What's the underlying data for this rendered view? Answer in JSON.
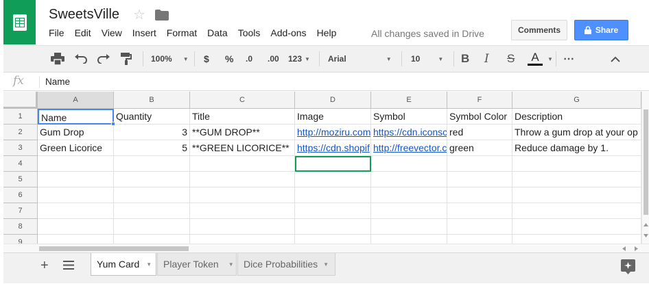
{
  "app": {
    "title": "SweetsVille",
    "saved_status": "All changes saved in Drive",
    "menu": [
      "File",
      "Edit",
      "View",
      "Insert",
      "Format",
      "Data",
      "Tools",
      "Add-ons",
      "Help"
    ],
    "comments_label": "Comments",
    "share_label": "Share"
  },
  "toolbar": {
    "zoom": "100%",
    "currency": "$",
    "percent": "%",
    "dec_decrease": ".0",
    "dec_increase": ".00",
    "more_formats": "123",
    "font": "Arial",
    "font_size": "10",
    "bold": "B",
    "italic": "I",
    "strike": "S",
    "text_color": "A",
    "more": "⋯",
    "collapse": "^"
  },
  "formula_bar": {
    "fx": "fx",
    "value": "Name"
  },
  "grid": {
    "columns": [
      "A",
      "B",
      "C",
      "D",
      "E",
      "F",
      "G"
    ],
    "row_numbers": [
      "1",
      "2",
      "3",
      "4",
      "5",
      "6",
      "7",
      "8",
      "9"
    ],
    "rows": [
      [
        "Name",
        "Quantity",
        "Title",
        "Image",
        "Symbol",
        "Symbol Color",
        "Description"
      ],
      [
        "Gum Drop",
        "3",
        "**GUM DROP**",
        "http://moziru.com",
        "https://cdn.iconsc",
        "red",
        "Throw a gum drop at your op"
      ],
      [
        "Green Licorice",
        "5",
        "**GREEN LICORICE**",
        "https://cdn.shopif",
        "http://freevector.c",
        "green",
        "Reduce damage by 1."
      ]
    ]
  },
  "sheets": {
    "tabs": [
      "Yum Card",
      "Player Token",
      "Dice Probabilities"
    ],
    "active": "Yum Card"
  },
  "colors": {
    "brand": "#0f9d58",
    "share": "#4d90fe",
    "selection": "#4285f4",
    "link": "#1155cc"
  }
}
